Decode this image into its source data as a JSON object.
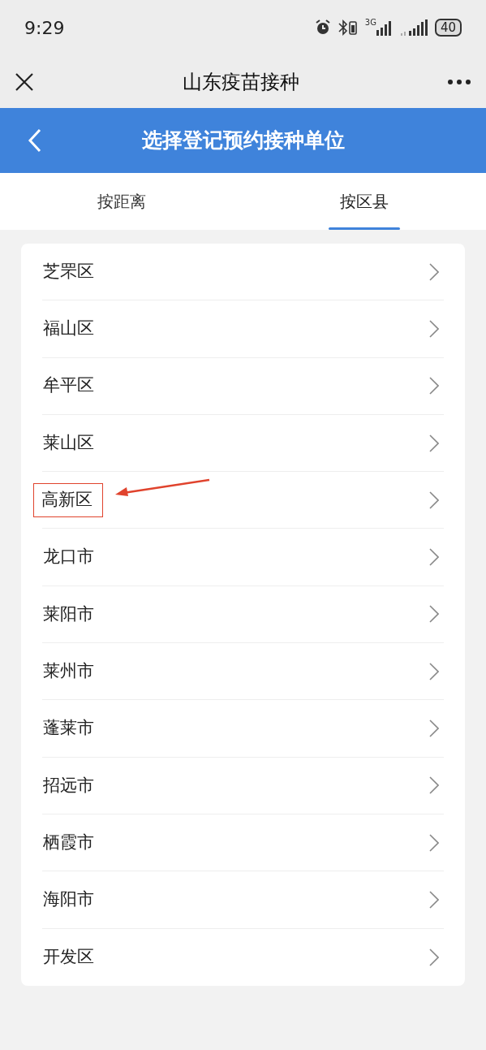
{
  "status_bar": {
    "time": "9:29",
    "network": "3G",
    "battery": "40"
  },
  "app_bar": {
    "title": "山东疫苗接种"
  },
  "header": {
    "title": "选择登记预约接种单位"
  },
  "tabs": [
    {
      "label": "按距离",
      "selected": false
    },
    {
      "label": "按区县",
      "selected": true
    }
  ],
  "districts": [
    {
      "name": "芝罘区",
      "highlighted": false
    },
    {
      "name": "福山区",
      "highlighted": false
    },
    {
      "name": "牟平区",
      "highlighted": false
    },
    {
      "name": "莱山区",
      "highlighted": false
    },
    {
      "name": "高新区",
      "highlighted": true
    },
    {
      "name": "龙口市",
      "highlighted": false
    },
    {
      "name": "莱阳市",
      "highlighted": false
    },
    {
      "name": "莱州市",
      "highlighted": false
    },
    {
      "name": "蓬莱市",
      "highlighted": false
    },
    {
      "name": "招远市",
      "highlighted": false
    },
    {
      "name": "栖霞市",
      "highlighted": false
    },
    {
      "name": "海阳市",
      "highlighted": false
    },
    {
      "name": "开发区",
      "highlighted": false
    }
  ]
}
